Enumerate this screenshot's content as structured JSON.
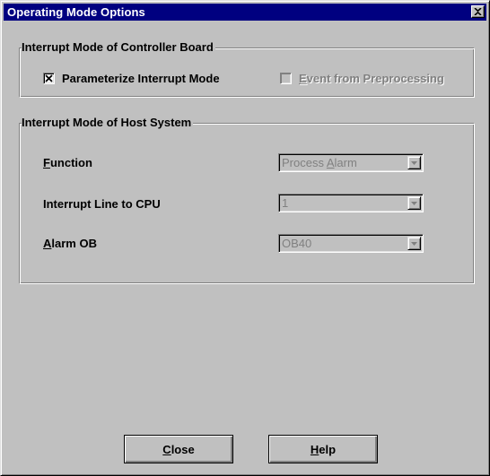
{
  "window": {
    "title": "Operating Mode Options"
  },
  "controller_group": {
    "title": "Interrupt Mode of Controller Board",
    "parameterize_checkbox": {
      "label": "Parameterize Interrupt Mode",
      "checked": true
    },
    "event_checkbox": {
      "label_prefix": "",
      "label_accel": "E",
      "label_rest": "vent from Preprocessing",
      "checked": false,
      "enabled": false
    }
  },
  "host_group": {
    "title": "Interrupt Mode of Host System",
    "function": {
      "label_accel": "F",
      "label_rest": "unction",
      "value_prefix": "Process ",
      "value_accel": "A",
      "value_rest": "larm"
    },
    "interrupt_line": {
      "label": "Interrupt Line to CPU",
      "value": "1"
    },
    "alarm_ob": {
      "label_accel": "A",
      "label_rest": "larm OB",
      "value": "OB40"
    }
  },
  "buttons": {
    "close": {
      "accel": "C",
      "rest": "lose"
    },
    "help": {
      "accel": "H",
      "rest": "elp"
    }
  },
  "colors": {
    "titlebar": "#000080",
    "face": "#c0c0c0",
    "disabled_text": "#808080"
  }
}
